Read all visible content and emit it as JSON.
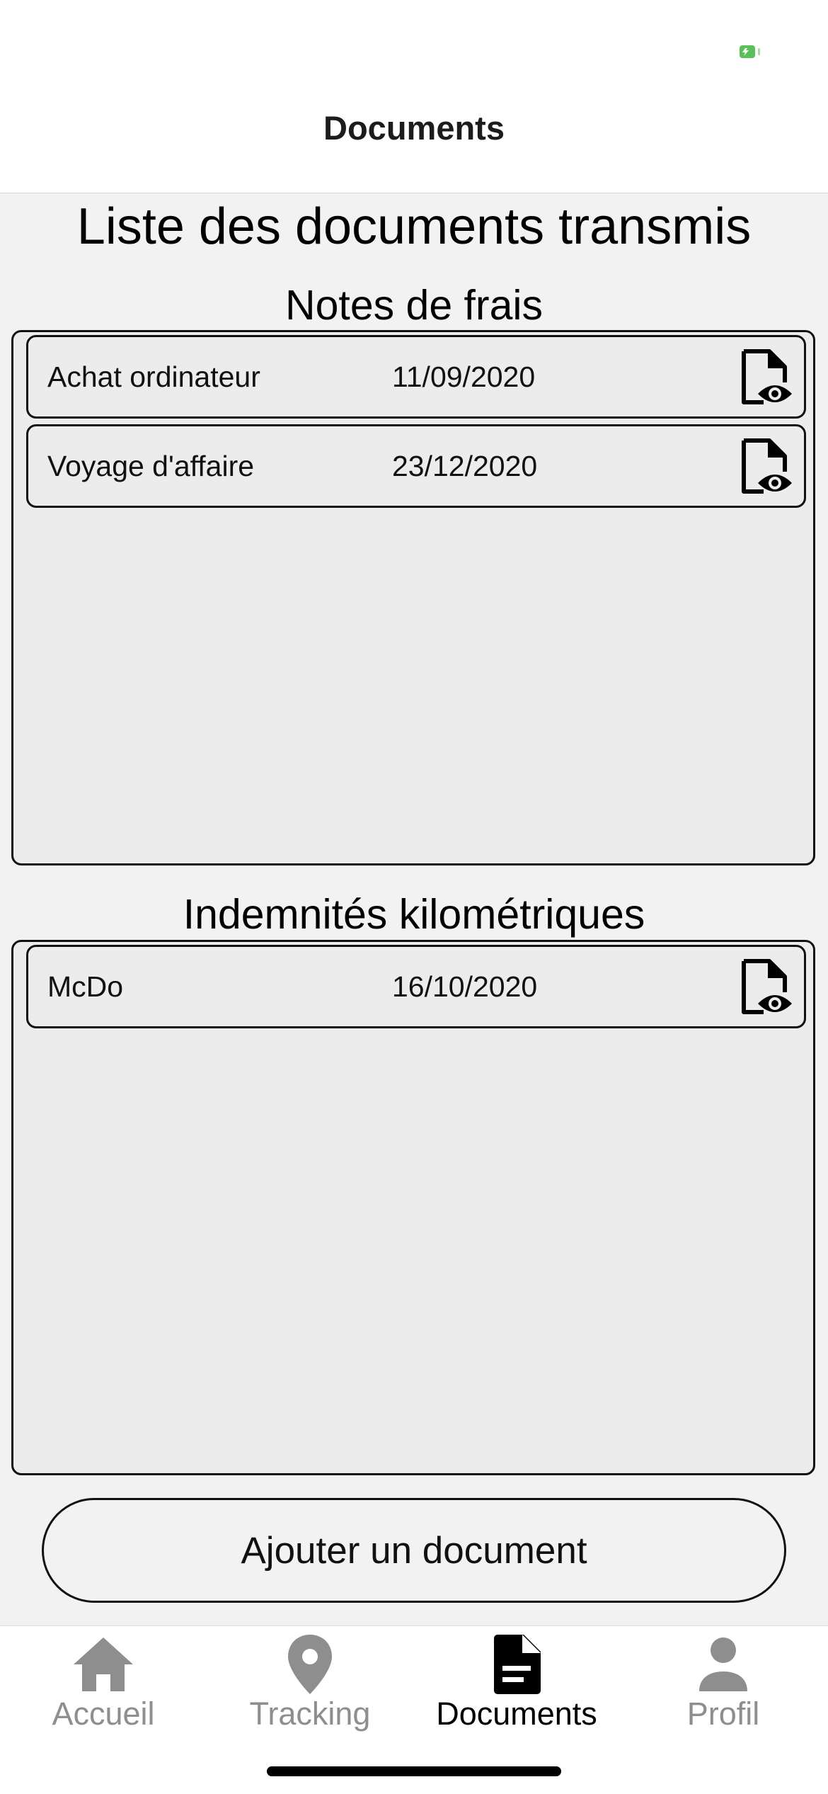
{
  "header": {
    "title": "Documents"
  },
  "main": {
    "title": "Liste des documents transmis",
    "sections": [
      {
        "title": "Notes de frais",
        "items": [
          {
            "name": "Achat ordinateur",
            "date": "11/09/2020"
          },
          {
            "name": "Voyage d'affaire",
            "date": "23/12/2020"
          }
        ]
      },
      {
        "title": "Indemnités kilométriques",
        "items": [
          {
            "name": "McDo",
            "date": "16/10/2020"
          }
        ]
      }
    ],
    "add_button_label": "Ajouter un document"
  },
  "tabbar": {
    "tabs": [
      {
        "label": "Accueil",
        "icon": "home-icon",
        "active": false
      },
      {
        "label": "Tracking",
        "icon": "map-pin-icon",
        "active": false
      },
      {
        "label": "Documents",
        "icon": "document-icon",
        "active": true
      },
      {
        "label": "Profil",
        "icon": "person-icon",
        "active": false
      }
    ]
  },
  "colors": {
    "background": "#f2f2f2",
    "panel": "#ececec",
    "border": "#111111",
    "tab_inactive": "#8e8e8e",
    "tab_active": "#000000",
    "battery": "#5ac15a"
  }
}
